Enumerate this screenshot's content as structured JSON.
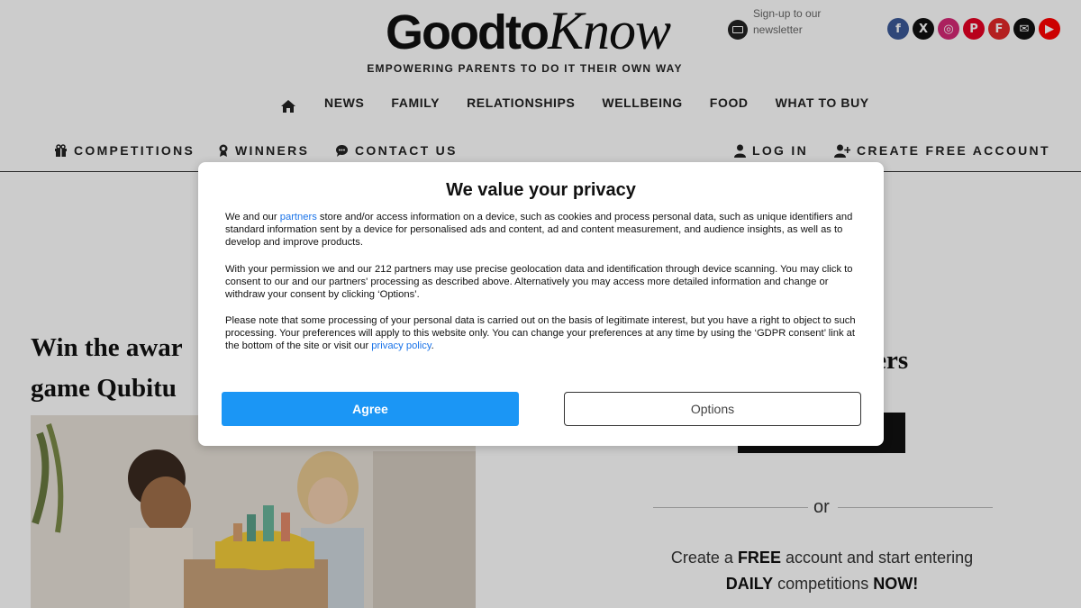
{
  "header": {
    "logo_part1": "Goodto",
    "logo_part2": "Know",
    "newsletter": "Sign-up to our newsletter",
    "tagline": "EMPOWERING PARENTS TO DO IT THEIR OWN WAY",
    "social": [
      {
        "name": "facebook-icon",
        "glyph": "f",
        "color": "#3b5998"
      },
      {
        "name": "x-icon",
        "glyph": "X",
        "color": "#111111"
      },
      {
        "name": "instagram-icon",
        "glyph": "◎",
        "color": "#d62976"
      },
      {
        "name": "pinterest-icon",
        "glyph": "P",
        "color": "#e60023"
      },
      {
        "name": "flipboard-icon",
        "glyph": "F",
        "color": "#e12828"
      },
      {
        "name": "email-icon",
        "glyph": "✉",
        "color": "#111111"
      },
      {
        "name": "youtube-icon",
        "glyph": "▶",
        "color": "#ff0000"
      }
    ]
  },
  "nav": {
    "items": [
      "NEWS",
      "FAMILY",
      "RELATIONSHIPS",
      "WELLBEING",
      "FOOD",
      "WHAT TO BUY"
    ]
  },
  "subnav": {
    "competitions": "COMPETITIONS",
    "winners": "WINNERS",
    "contact": "CONTACT US",
    "login": "LOG IN",
    "create_account": "CREATE FREE ACCOUNT"
  },
  "content": {
    "headline_line1": "Win the awar",
    "headline_line2": "game Qubitu",
    "side_title": "bers",
    "or": "or",
    "create_prefix": "Create a ",
    "create_free": "FREE",
    "create_mid": " account and start entering",
    "create_daily": "DAILY",
    "create_competitions": " competitions ",
    "create_now": "NOW!"
  },
  "consent": {
    "title": "We value your privacy",
    "p1_a": "We and our ",
    "p1_link": "partners",
    "p1_b": " store and/or access information on a device, such as cookies and process personal data, such as unique identifiers and standard information sent by a device for personalised ads and content, ad and content measurement, and audience insights, as well as to develop and improve products.",
    "p2": "With your permission we and our 212 partners may use precise geolocation data and identification through device scanning. You may click to consent to our and our partners' processing as described above. Alternatively you may access more detailed information and change or withdraw your consent by clicking ‘Options’.",
    "p3_a": "Please note that some processing of your personal data is carried out on the basis of legitimate interest, but you have a right to object to such processing. Your preferences will apply to this website only. You can change your preferences at any time by using the ‘GDPR consent’ link at the bottom of the site or visit our ",
    "p3_link": "privacy policy",
    "p3_b": ".",
    "agree": "Agree",
    "options": "Options"
  }
}
